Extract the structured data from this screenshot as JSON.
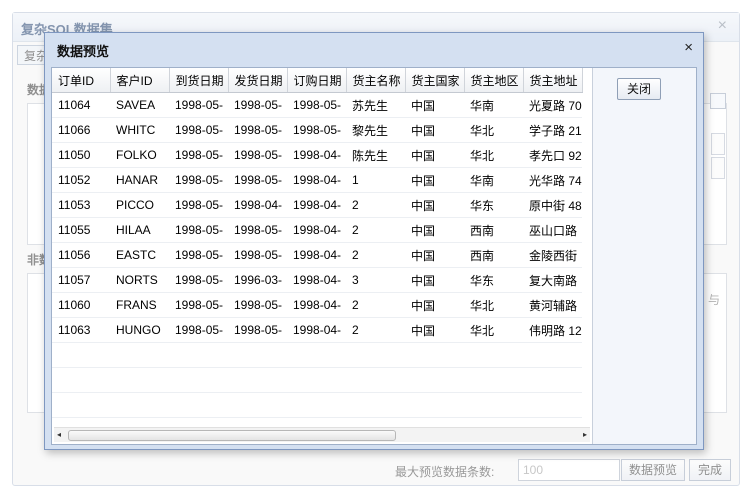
{
  "background": {
    "title": "复杂SQL数据集",
    "tab_label": "复杂",
    "section1_label": "数据",
    "section2_label": "非数",
    "side_text": "与",
    "max_rows_label": "最大预览数据条数:",
    "max_rows_value": "100",
    "preview_button": "数据预览",
    "finish_button": "完成",
    "close_icon": "×"
  },
  "modal": {
    "title": "数据预览",
    "close_icon": "×",
    "close_button": "关闭",
    "columns": [
      "订单ID",
      "客户ID",
      "到货日期",
      "发货日期",
      "订购日期",
      "货主名称",
      "货主国家",
      "货主地区",
      "货主地址"
    ],
    "rows": [
      [
        "11064",
        "SAVEA",
        "1998-05-",
        "1998-05-",
        "1998-05-",
        "苏先生",
        "中国",
        "华南",
        "光夏路 70"
      ],
      [
        "11066",
        "WHITC",
        "1998-05-",
        "1998-05-",
        "1998-05-",
        "黎先生",
        "中国",
        "华北",
        "学子路 21"
      ],
      [
        "11050",
        "FOLKO",
        "1998-05-",
        "1998-05-",
        "1998-04-",
        "陈先生",
        "中国",
        "华北",
        "孝先口 92"
      ],
      [
        "11052",
        "HANAR",
        "1998-05-",
        "1998-05-",
        "1998-04-",
        "1",
        "中国",
        "华南",
        "光华路 74"
      ],
      [
        "11053",
        "PICCO",
        "1998-05-",
        "1998-04-",
        "1998-04-",
        "2",
        "中国",
        "华东",
        "原中街 48"
      ],
      [
        "11055",
        "HILAA",
        "1998-05-",
        "1998-05-",
        "1998-04-",
        "2",
        "中国",
        "西南",
        "巫山口路"
      ],
      [
        "11056",
        "EASTC",
        "1998-05-",
        "1998-05-",
        "1998-04-",
        "2",
        "中国",
        "西南",
        "金陵西街"
      ],
      [
        "11057",
        "NORTS",
        "1998-05-",
        "1996-03-",
        "1998-04-",
        "3",
        "中国",
        "华东",
        "复大南路"
      ],
      [
        "11060",
        "FRANS",
        "1998-05-",
        "1998-05-",
        "1998-04-",
        "2",
        "中国",
        "华北",
        "黄河辅路"
      ],
      [
        "11063",
        "HUNGO",
        "1998-05-",
        "1998-05-",
        "1998-04-",
        "2",
        "中国",
        "华北",
        "伟明路 12"
      ]
    ],
    "scroll_left_icon": "◂",
    "scroll_right_icon": "▸"
  }
}
